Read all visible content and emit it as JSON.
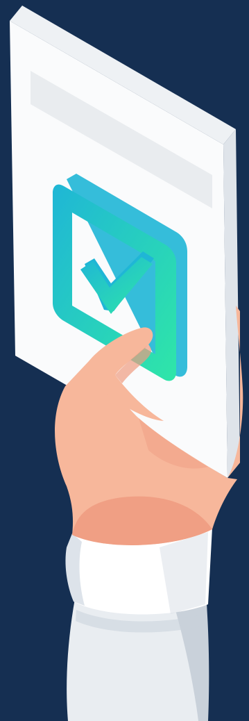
{
  "illustration": {
    "subject": "hand-holding-approved-document-icon",
    "icons": [
      "document-icon",
      "checkbox-icon",
      "checkmark-icon",
      "hand-icon",
      "shirt-cuff-icon",
      "sleeve-icon"
    ]
  },
  "colors": {
    "background": "#152f52",
    "paper_front": "#fafbfc",
    "paper_side": "#dfe4ea",
    "paper_top": "#eef1f4",
    "text_placeholder": "#e9ecef",
    "check_green": "#2fe6a8",
    "check_blue": "#1fb6d6",
    "skin": "#f7b79b",
    "skin_shadow": "#ee9b80",
    "cuff": "#ffffff",
    "cuff_shadow": "#dde3ea",
    "sleeve": "#e9edf1",
    "sleeve_shadow": "#c9d1da"
  }
}
